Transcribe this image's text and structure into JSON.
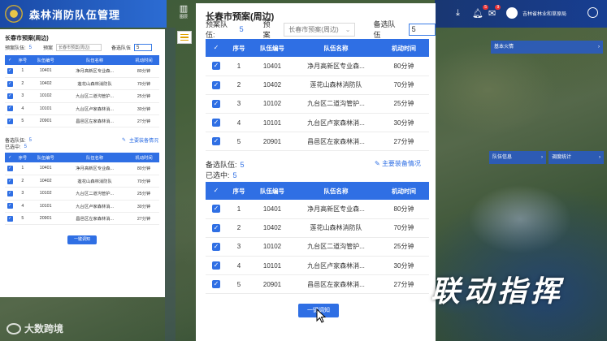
{
  "app": {
    "title": "森林消防队伍管理"
  },
  "header": {
    "user_name": "吉林省林业和草原局",
    "badges": {
      "bell": "5",
      "message": "9"
    },
    "chart_button_label": "图层"
  },
  "left_panel": {
    "title": "长春市预案(周边)",
    "plan_teams_label": "预案队伍:",
    "plan_teams_count": "5",
    "plan_label": "预案",
    "plan_select_value": "长春市预案(周边)",
    "candidate_label": "备选队伍",
    "candidate_value": "5",
    "columns": [
      "序号",
      "队伍编号",
      "队伍名称",
      "机动时间"
    ],
    "rows1": [
      [
        "1",
        "10401",
        "净月高新区专业森...",
        "80分钟"
      ],
      [
        "2",
        "10402",
        "莲花山森林消防队",
        "70分钟"
      ],
      [
        "3",
        "10102",
        "九台区二道沟管护...",
        "25分钟"
      ],
      [
        "4",
        "10101",
        "九台区卢家森林消...",
        "30分钟"
      ],
      [
        "5",
        "20901",
        "昌邑区左家森林消...",
        "27分钟"
      ]
    ],
    "backup_label": "备选队伍:",
    "backup_count": "5",
    "selected_label": "已选中:",
    "selected_count": "5",
    "equipment_link": "主要装备情况",
    "rows2": [
      [
        "1",
        "10401",
        "净月高新区专业森...",
        "80分钟"
      ],
      [
        "2",
        "10402",
        "莲花山森林消防队",
        "70分钟"
      ],
      [
        "3",
        "10102",
        "九台区二道沟管护...",
        "25分钟"
      ],
      [
        "4",
        "10101",
        "九台区卢家森林消...",
        "30分钟"
      ],
      [
        "5",
        "20901",
        "昌邑区左家森林消...",
        "27分钟"
      ]
    ],
    "dispatch_button": "一键调知"
  },
  "dialog": {
    "title": "长春市预案(周边)",
    "plan_teams_label": "预案队伍:",
    "plan_teams_count": "5",
    "plan_label": "预案",
    "plan_select_value": "长春市预案(周边)",
    "candidate_label": "备选队伍",
    "candidate_value": "5",
    "columns": [
      "序号",
      "队伍编号",
      "队伍名称",
      "机动时间"
    ],
    "rows1": [
      [
        "1",
        "10401",
        "净月高新区专业森...",
        "80分钟"
      ],
      [
        "2",
        "10402",
        "莲花山森林消防队",
        "70分钟"
      ],
      [
        "3",
        "10102",
        "九台区二道沟管护...",
        "25分钟"
      ],
      [
        "4",
        "10101",
        "九台区卢家森林消...",
        "30分钟"
      ],
      [
        "5",
        "20901",
        "昌邑区左家森林消...",
        "27分钟"
      ]
    ],
    "backup_label": "备选队伍:",
    "backup_count": "5",
    "selected_label": "已选中:",
    "selected_count": "5",
    "equipment_link": "主要装备情况",
    "rows2": [
      [
        "1",
        "10401",
        "净月高新区专业森...",
        "80分钟"
      ],
      [
        "2",
        "10402",
        "莲花山森林消防队",
        "70分钟"
      ],
      [
        "3",
        "10102",
        "九台区二道沟管护...",
        "25分钟"
      ],
      [
        "4",
        "10101",
        "九台区卢家森林消...",
        "30分钟"
      ],
      [
        "5",
        "20901",
        "昌邑区左家森林消...",
        "27分钟"
      ]
    ],
    "dispatch_button": "一键调知"
  },
  "map_cards": {
    "basic_info": "基本火情",
    "team_info": "队伍信息",
    "stats": "调度统计"
  },
  "caption": "联动指挥",
  "watermark": "大数跨境",
  "colors": {
    "primary": "#2f6fe4",
    "header": "#1a4aa6"
  }
}
